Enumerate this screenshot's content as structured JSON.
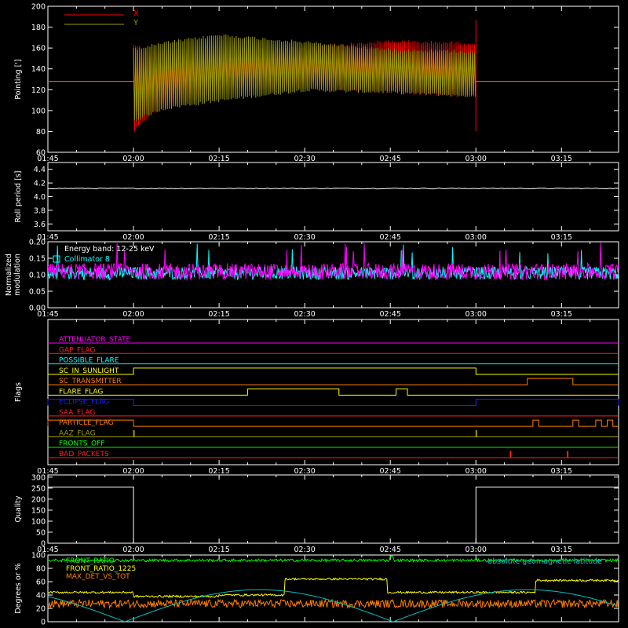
{
  "time_axis": {
    "tick_labels": [
      "01:45",
      "02:00",
      "02:15",
      "02:30",
      "02:45",
      "03:00",
      "03:15"
    ],
    "tick_minutes": [
      105,
      120,
      135,
      150,
      165,
      180,
      195
    ],
    "range_minutes": [
      105,
      205
    ],
    "minor_step_minutes": 5
  },
  "chart_data": [
    {
      "type": "line",
      "ylabel": "Pointing [']",
      "ylim": [
        60,
        200
      ],
      "yticks": [
        "60",
        "80",
        "100",
        "120",
        "140",
        "160",
        "180",
        "200"
      ],
      "series": [
        {
          "name": "X",
          "color": "#ff0000",
          "baseline": 128,
          "active_range": [
            "02:00",
            "03:00"
          ],
          "upper_envelope": [
            [
              120,
              165
            ],
            [
              123,
              158
            ],
            [
              135,
              158
            ],
            [
              150,
              162
            ],
            [
              165,
              168
            ],
            [
              180,
              166
            ]
          ],
          "lower_envelope": [
            [
              120,
              78
            ],
            [
              123,
              95
            ],
            [
              135,
              118
            ],
            [
              150,
              121
            ],
            [
              165,
              116
            ],
            [
              180,
              112
            ]
          ],
          "spike_at_03_00": [
            80,
            187
          ]
        },
        {
          "name": "Y",
          "color": "#9b9b00",
          "baseline": 128,
          "active_range": [
            "02:00",
            "03:00"
          ],
          "upper_envelope": [
            [
              120,
              160
            ],
            [
              125,
              166
            ],
            [
              135,
              174
            ],
            [
              150,
              167
            ],
            [
              165,
              160
            ],
            [
              180,
              158
            ]
          ],
          "lower_envelope": [
            [
              120,
              88
            ],
            [
              125,
              100
            ],
            [
              135,
              108
            ],
            [
              150,
              118
            ],
            [
              165,
              116
            ],
            [
              180,
              112
            ]
          ]
        }
      ]
    },
    {
      "type": "line",
      "ylabel": "Roll period [s]",
      "ylim": [
        3.5,
        4.5
      ],
      "yticks": [
        "3.6",
        "3.8",
        "4.0",
        "4.2",
        "4.4"
      ],
      "series": [
        {
          "color": "#ffffff",
          "value": 4.12
        }
      ]
    },
    {
      "type": "line",
      "ylabel": "Normalized modulation",
      "ylim": [
        0,
        0.2
      ],
      "yticks": [
        "0.00",
        "0.05",
        "0.10",
        "0.15",
        "0.20"
      ],
      "annotation": "Energy band: 12-25 keV",
      "series": [
        {
          "name": "Collimator 8",
          "color": "#00ffff",
          "mean": 0.105,
          "spread": 0.02
        },
        {
          "color": "#ff00ff",
          "mean": 0.11,
          "spread": 0.025
        }
      ]
    },
    {
      "type": "line",
      "ylabel": "Flags",
      "flags": [
        {
          "name": "ATTENUATOR_STATE",
          "color": "#ff00ff",
          "high": []
        },
        {
          "name": "GAP_FLAG",
          "color": "#ff2020",
          "high": []
        },
        {
          "name": "POSSIBLE_FLARE",
          "color": "#00ffff",
          "high": []
        },
        {
          "name": "SC_IN_SUNLIGHT",
          "color": "#ffff00",
          "high": [
            [
              "02:00",
              "03:00"
            ]
          ]
        },
        {
          "name": "SC_TRANSMITTER",
          "color": "#ff7f00",
          "high": [
            [
              "03:09",
              "03:17"
            ]
          ]
        },
        {
          "name": "FLARE_FLAG",
          "color": "#ffff00",
          "high": [
            [
              "02:20",
              "02:36"
            ],
            [
              "02:46",
              "02:48"
            ]
          ]
        },
        {
          "name": "ECLIPSE_FLAG",
          "color": "#2020ff",
          "high": [
            [
              "01:45",
              "02:00"
            ],
            [
              "03:00",
              "03:25"
            ]
          ]
        },
        {
          "name": "SAA_FLAG",
          "color": "#ff2020",
          "high": []
        },
        {
          "name": "PARTICLE_FLAG",
          "color": "#ff7f00",
          "high": [
            [
              "01:45",
              "02:00"
            ],
            [
              "03:10",
              "03:11"
            ],
            [
              "03:17",
              "03:18"
            ],
            [
              "03:21",
              "03:22"
            ],
            [
              "03:23",
              "03:24"
            ]
          ]
        },
        {
          "name": "AAZ_FLAG",
          "color": "#9b9b00",
          "high": [
            [
              "02:00",
              "02:00"
            ],
            [
              "03:00",
              "03:00"
            ]
          ]
        },
        {
          "name": "FRONTS_OFF",
          "color": "#00ff00",
          "high": []
        },
        {
          "name": "BAD_PACKETS",
          "color": "#ff2020",
          "high": [
            [
              "03:06",
              "03:06"
            ],
            [
              "03:16",
              "03:16"
            ]
          ]
        }
      ]
    },
    {
      "type": "line",
      "ylabel": "Quality",
      "ylim": [
        0,
        310
      ],
      "yticks": [
        "0",
        "50",
        "100",
        "150",
        "200",
        "250",
        "300"
      ],
      "series": [
        {
          "color": "#ffffff",
          "segments": [
            [
              [
                "01:45",
                255
              ],
              [
                "02:00",
                255
              ],
              [
                "02:00",
                0
              ]
            ],
            [
              [
                "03:00",
                0
              ],
              [
                "03:00",
                255
              ],
              [
                "03:25",
                255
              ]
            ]
          ]
        }
      ]
    },
    {
      "type": "line",
      "ylabel": "Degrees or %",
      "ylim": [
        0,
        100
      ],
      "yticks": [
        "0",
        "20",
        "40",
        "60",
        "80",
        "100"
      ],
      "series": [
        {
          "name": "FRONT_RATIO",
          "color": "#00ff00",
          "steps": [
            [
              105,
              92
            ],
            [
              165,
              99
            ],
            [
              165.5,
              92
            ],
            [
              171,
              92
            ],
            [
              195,
              92
            ],
            [
              205,
              92
            ]
          ]
        },
        {
          "name": "FRONT_RATIO_1225",
          "color": "#ffff00",
          "steps": [
            [
              105,
              44
            ],
            [
              120,
              38
            ],
            [
              135,
              40
            ],
            [
              146,
              40
            ],
            [
              146.5,
              64
            ],
            [
              164,
              64
            ],
            [
              164.5,
              44
            ],
            [
              190,
              44
            ],
            [
              190.5,
              62
            ],
            [
              205,
              60
            ]
          ]
        },
        {
          "name": "MAX_DET_VS_TOT",
          "color": "#ff7f00",
          "mean": 27,
          "spread": 6
        },
        {
          "name": "absolute geomagnetic latitude",
          "color": "#00c0c0",
          "sine": {
            "min": 0,
            "max": 48,
            "period_minutes": 47,
            "phase_minutes": 118.5
          }
        }
      ]
    }
  ]
}
